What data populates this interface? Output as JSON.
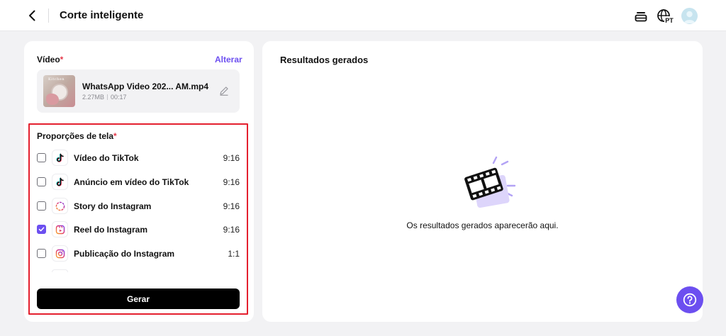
{
  "header": {
    "title": "Corte inteligente",
    "language_badge": "PT"
  },
  "left_panel": {
    "video_label": "Vídeo",
    "required_mark": "*",
    "change_link": "Alterar",
    "video": {
      "thumbnail_text": "Kitchen",
      "name": "WhatsApp Video 202... AM.mp4",
      "size": "2.27MB",
      "duration": "00:17"
    },
    "ratios_label": "Proporções de tela",
    "ratios_required_mark": "*",
    "ratios": [
      {
        "name": "Vídeo do TikTok",
        "ratio": "9:16",
        "checked": false,
        "icon": "tiktok-icon"
      },
      {
        "name": "Anúncio em vídeo do TikTok",
        "ratio": "9:16",
        "checked": false,
        "icon": "tiktok-icon"
      },
      {
        "name": "Story do Instagram",
        "ratio": "9:16",
        "checked": false,
        "icon": "instagram-story-icon"
      },
      {
        "name": "Reel do Instagram",
        "ratio": "9:16",
        "checked": true,
        "icon": "instagram-reel-icon"
      },
      {
        "name": "Publicação do Instagram",
        "ratio": "1:1",
        "checked": false,
        "icon": "instagram-icon"
      }
    ],
    "generate_button": "Gerar"
  },
  "right_panel": {
    "title": "Resultados gerados",
    "empty_message": "Os resultados gerados aparecerão aqui."
  },
  "colors": {
    "accent": "#6c4ff0",
    "highlight_frame": "#e4202e",
    "background": "#f2f2f4"
  }
}
